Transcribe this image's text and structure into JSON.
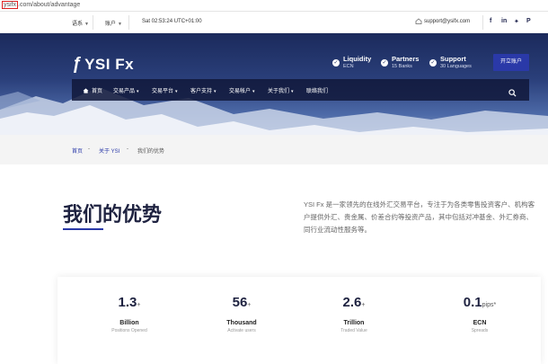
{
  "browser": {
    "url_highlight": "ysifx",
    "url_rest": ".com/about/advantage"
  },
  "topbar": {
    "language": "语系",
    "account": "账户",
    "server_time": "Sat 02:53:24 UTC+01:00",
    "email": "support@ysifx.com",
    "social_icons": [
      "facebook-icon",
      "linkedin-icon",
      "twitter-icon",
      "pinterest-icon"
    ]
  },
  "header": {
    "logo_text": "YSI Fx",
    "features": [
      {
        "title": "Liquidity",
        "subtitle": "ECN"
      },
      {
        "title": "Partners",
        "subtitle": "15 Banks"
      },
      {
        "title": "Support",
        "subtitle": "30 Languages"
      }
    ],
    "open_account": "开立账户"
  },
  "nav": {
    "items": [
      "首页",
      "交易产品",
      "交易平台",
      "客户支持",
      "交易帐户",
      "关于我们",
      "联络我们"
    ],
    "dropdown_flags": [
      false,
      true,
      true,
      true,
      true,
      true,
      false
    ]
  },
  "breadcrumb": {
    "home": "首页",
    "sep": "-",
    "parent": "关于 YSI",
    "current": "我们的优势"
  },
  "main": {
    "title": "我们的优势",
    "intro": "YSI Fx 是一家领先的在线外汇交易平台，专注于为各类零售投资客户、机构客户提供外汇、贵金属、价差合约等投资产品，其中包括对冲基金、外汇券商、同行业流动性服务等。"
  },
  "stats": [
    {
      "value": "1.3",
      "suffix": "+",
      "label": "Billion",
      "desc": "Positions Opened"
    },
    {
      "value": "56",
      "suffix": "+",
      "label": "Thousand",
      "desc": "Activate users"
    },
    {
      "value": "2.6",
      "suffix": "+",
      "label": "Trillion",
      "desc": "Traded Value"
    },
    {
      "value": "0.1",
      "suffix": "pips*",
      "label": "ECN",
      "desc": "Spreads"
    }
  ],
  "colors": {
    "brand_blue": "#2a39a8",
    "hero_dark": "#1b2a5c",
    "title_text": "#1e2240"
  }
}
